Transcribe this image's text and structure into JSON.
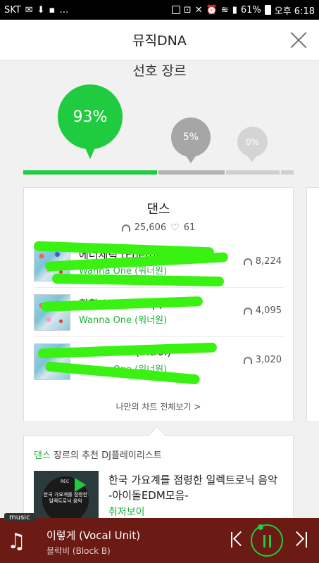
{
  "status_bar": {
    "carrier": "SKT",
    "battery": "61%",
    "time": "오후 6:18"
  },
  "header": {
    "title": "뮤직DNA"
  },
  "genre_section": {
    "title": "선호 장르",
    "bubbles": [
      "93%",
      "5%",
      "0%"
    ],
    "shares": [
      0.93,
      0.05,
      0.0
    ]
  },
  "genre_card": {
    "name": "댄스",
    "plays": "25,606",
    "likes": "61",
    "tracks": [
      {
        "title": "에너제틱 (Energetic)",
        "artist": "Wanna One (워너원)",
        "plays": "8,224"
      },
      {
        "title": "활활 (Burn It Up)",
        "artist": "Wanna One (워너원)",
        "plays": "4,095"
      },
      {
        "title": "To Be One (Intro.)",
        "artist": "Wanna One (워너원)",
        "plays": "3,020"
      }
    ],
    "chart_link": "나만의 차트 전체보기 >"
  },
  "playlist": {
    "genre_accent": "댄스",
    "header_rest": " 장르의 추천 DJ플레이리스트",
    "thumb_text": "한국 가요계를 점령한 일렉트로닉 음악",
    "thumb_label": "REC",
    "title": "한국 가요계를 점령한 일렉트로닉 음악 -아이돌EDM모음-",
    "sub": "취저보이"
  },
  "player": {
    "tag": "music",
    "track": "이렇게 (Vocal Unit)",
    "artist": "블락비 (Block B)"
  },
  "colors": {
    "accent": "#1fcb3f",
    "player_bg": "#6b1a14"
  }
}
